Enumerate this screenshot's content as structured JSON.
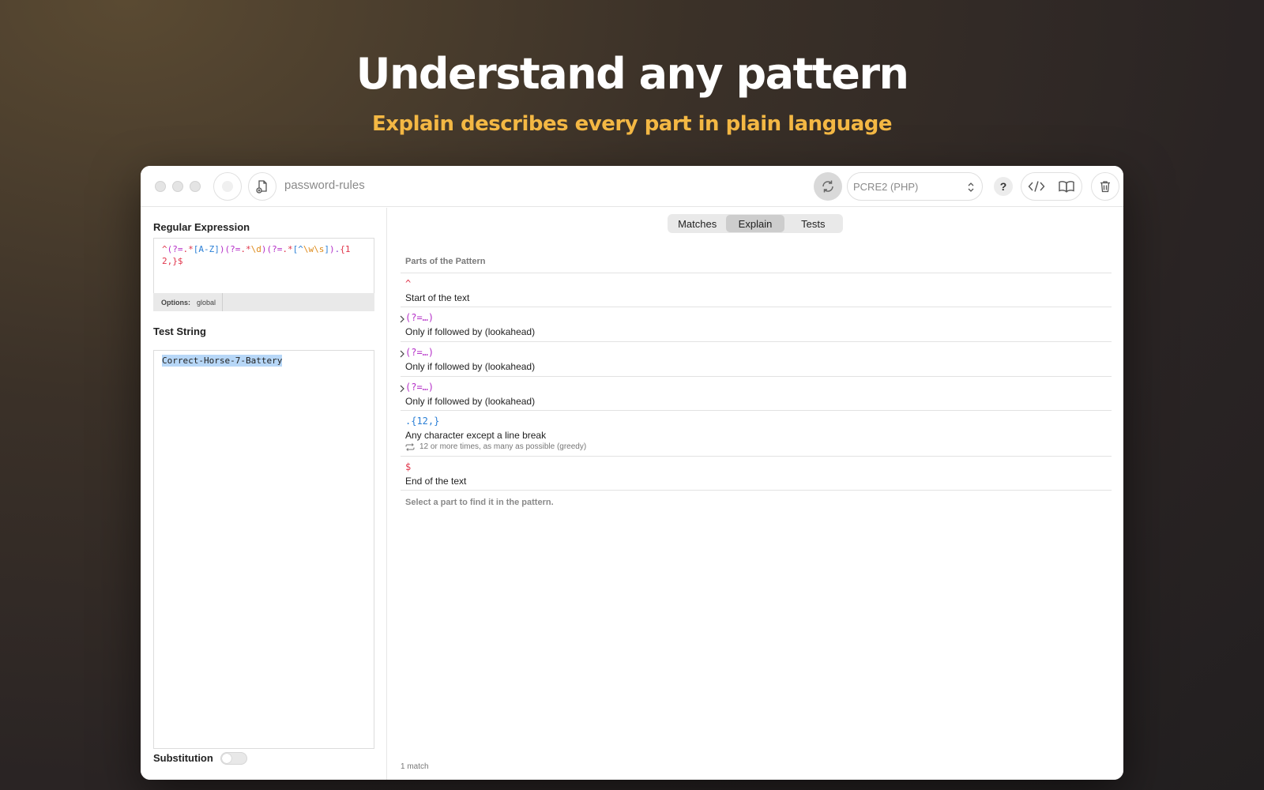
{
  "hero": {
    "title": "Understand any pattern",
    "subtitle": "Explain describes every part in plain language"
  },
  "colors": {
    "accent_subtitle": "#f4b844",
    "token_anchor": "#e0344a",
    "token_group": "#b530c8",
    "token_class": "#2a7fd6",
    "token_escape": "#dd8a1a",
    "selection": "#b7d7f7"
  },
  "titlebar": {
    "document_title": "password-rules",
    "flavor": "PCRE2 (PHP)",
    "help_label": "?",
    "icons": [
      "traffic-light",
      "record-icon",
      "new-document-icon",
      "refresh-icon",
      "chevron-updown-icon",
      "code-icon",
      "book-icon",
      "trash-icon"
    ]
  },
  "left": {
    "regex_label": "Regular Expression",
    "regex_tokens": [
      {
        "t": "^",
        "c": "red"
      },
      {
        "t": "(?=",
        "c": "mag"
      },
      {
        "t": ".*",
        "c": "red"
      },
      {
        "t": "[A-Z]",
        "c": "blue"
      },
      {
        "t": ")",
        "c": "mag"
      },
      {
        "t": "(?=",
        "c": "mag"
      },
      {
        "t": ".*",
        "c": "red"
      },
      {
        "t": "\\d",
        "c": "orange"
      },
      {
        "t": ")",
        "c": "mag"
      },
      {
        "t": "(?=",
        "c": "mag"
      },
      {
        "t": ".*",
        "c": "red"
      },
      {
        "t": "[^",
        "c": "blue"
      },
      {
        "t": "\\w\\s",
        "c": "orange"
      },
      {
        "t": "]",
        "c": "blue"
      },
      {
        "t": ")",
        "c": "mag"
      },
      {
        "t": ".",
        "c": "purple"
      },
      {
        "t": "{12,}",
        "c": "red"
      },
      {
        "t": "$",
        "c": "red"
      }
    ],
    "options_label": "Options:",
    "options_value": "global",
    "test_label": "Test String",
    "test_value": "Correct-Horse-7-Battery",
    "substitution_label": "Substitution"
  },
  "right": {
    "tabs": [
      {
        "label": "Matches",
        "active": false
      },
      {
        "label": "Explain",
        "active": true
      },
      {
        "label": "Tests",
        "active": false
      }
    ],
    "parts_header": "Parts of the Pattern",
    "parts": [
      {
        "token": "^",
        "color": "red",
        "desc": "Start of the text",
        "expandable": false,
        "note": ""
      },
      {
        "token": "(?=…)",
        "color": "mag",
        "desc": "Only if followed by (lookahead)",
        "expandable": true,
        "note": ""
      },
      {
        "token": "(?=…)",
        "color": "mag",
        "desc": "Only if followed by (lookahead)",
        "expandable": true,
        "note": ""
      },
      {
        "token": "(?=…)",
        "color": "mag",
        "desc": "Only if followed by (lookahead)",
        "expandable": true,
        "note": ""
      },
      {
        "token": ".{12,}",
        "color": "blue",
        "desc": "Any character except a line break",
        "expandable": false,
        "note": "12 or more times, as many as possible (greedy)"
      },
      {
        "token": "$",
        "color": "red",
        "desc": "End of the text",
        "expandable": false,
        "note": ""
      }
    ],
    "footer_hint": "Select a part to find it in the pattern.",
    "match_count": "1 match"
  }
}
